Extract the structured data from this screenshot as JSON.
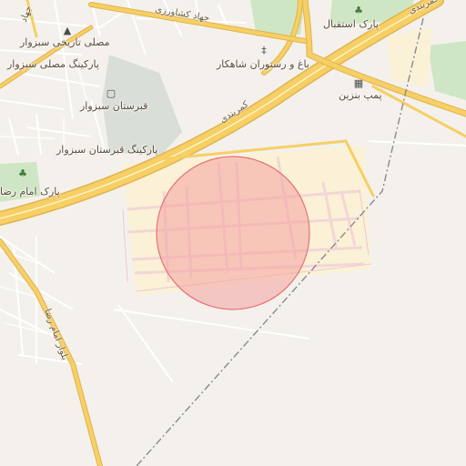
{
  "map": {
    "labels": {
      "jahad_keshavarzi": "جهاد کشاورزی",
      "mosalla": "مصلی تاریخی سبزوار",
      "parking_mosalla": "پارکینگ مصلی سبزوار",
      "qabrestan": "قبرستان سبزوار",
      "parking_qabrestan": "پارکینگ قبرستان سبزوار",
      "park_emam_reza": "پارک امام رضا",
      "bagh_restoran": "باغ و رستوران شاهکار",
      "park_esteghlal": "پارک استقبال",
      "pomp_benzin": "پمپ بنزین",
      "kamarbandi_1": "کمربندی",
      "kamarbandi_2": "کمربندی",
      "bolvar_emam_reza": "بلوار امام رضا",
      "jahad_short": "جهاد"
    },
    "icons": {
      "monument": "monument-icon",
      "cemetery": "cemetery-icon",
      "park_tree": "park-tree-icon",
      "restaurant": "restaurant-icon",
      "fuel": "fuel-icon"
    },
    "highlight_circle": {
      "fill": "#f4a3a3",
      "stroke": "#e57373"
    },
    "colors": {
      "background": "#f4f1ec",
      "major_road": "#f6cf65",
      "major_road_casing": "#e0b451",
      "minor_road": "#ffffff",
      "park": "#cfe6c4",
      "cemetery": "#d9dfd6",
      "development": "#fbf1d6",
      "railway": "#8a8a8a"
    }
  }
}
